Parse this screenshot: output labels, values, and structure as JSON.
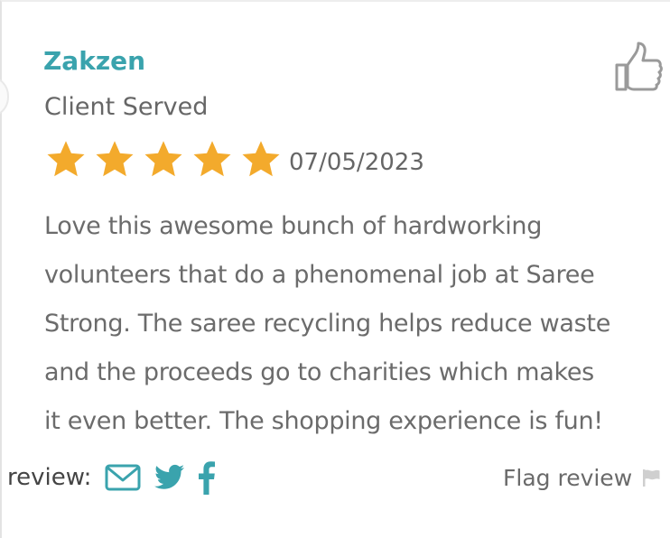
{
  "review": {
    "reviewer_name": "Zakzen",
    "reviewer_role": "Client Served",
    "rating": 5,
    "rating_max": 5,
    "date": "07/05/2023",
    "text_lines": [
      "Love this awesome bunch of hardworking",
      "volunteers that do a phenomenal job at Saree",
      "Strong. The saree recycling helps reduce waste",
      "and the proceeds go to charities which makes",
      "it even better. The shopping experience is fun!"
    ]
  },
  "share": {
    "label": "review:",
    "icons": [
      "email-icon",
      "twitter-icon",
      "facebook-icon"
    ]
  },
  "flag": {
    "label": "Flag review",
    "icon": "flag-icon"
  },
  "helpful": {
    "icon": "thumbs-up-icon"
  },
  "colors": {
    "accent": "#3aa3ad",
    "star": "#f3aa2c",
    "text": "#6b6b6b",
    "icon_gray": "#9a9a9a",
    "flag_gray": "#cfcfcf"
  }
}
